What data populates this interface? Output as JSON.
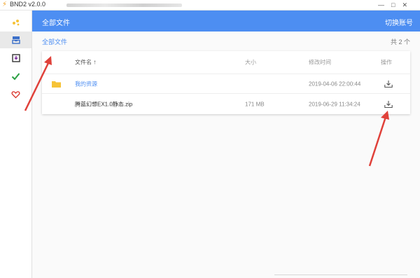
{
  "window": {
    "title": "BND2 v2.0.0"
  },
  "header": {
    "path_title": "全部文件",
    "switch_account": "切换账号"
  },
  "breadcrumb": {
    "root": "全部文件"
  },
  "summary": {
    "count_text": "共 2 个"
  },
  "table": {
    "columns": {
      "name": "文件名",
      "size": "大小",
      "modified": "修改时间",
      "actions": "操作"
    },
    "rows": [
      {
        "type": "folder",
        "name": "我的资源",
        "size": "",
        "modified": "2019-04-06 22:00:44"
      },
      {
        "type": "file",
        "name": "腾蓝幻想EX1.0静态.zip",
        "size": "171 MB",
        "modified": "2019-06-29 11:34:24"
      }
    ]
  },
  "sidebar": {
    "items": [
      {
        "icon": "logo-dots-icon"
      },
      {
        "icon": "files-icon",
        "active": true
      },
      {
        "icon": "download-box-icon"
      },
      {
        "icon": "check-icon"
      },
      {
        "icon": "heart-icon"
      }
    ]
  },
  "colors": {
    "accent": "#4d8ef2",
    "folder": "#f6c338",
    "check": "#2aa043",
    "heart": "#d9342b",
    "annotation": "#e0413a"
  }
}
